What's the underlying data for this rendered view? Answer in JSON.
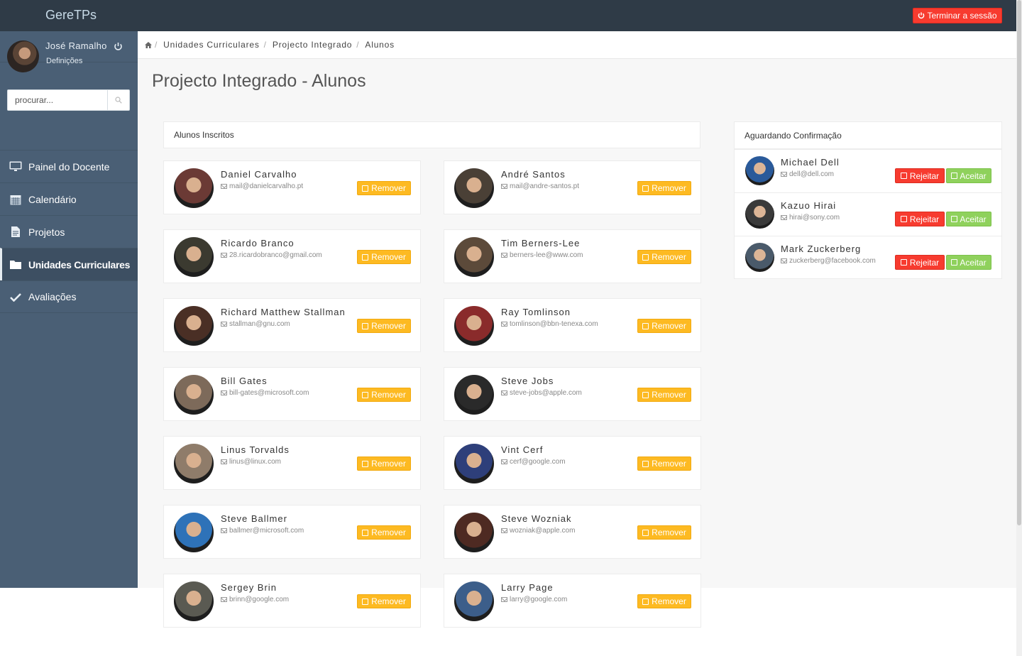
{
  "app": {
    "brand": "GereTPs",
    "logout_label": "Terminar a sessão"
  },
  "sidebar": {
    "user_name": "José Ramalho",
    "settings_label": "Definições",
    "search_placeholder": "procurar...",
    "items": [
      {
        "label": "Painel do Docente",
        "icon": "monitor-icon"
      },
      {
        "label": "Calendário",
        "icon": "calendar-icon"
      },
      {
        "label": "Projetos",
        "icon": "document-icon"
      },
      {
        "label": "Unidades Curriculares",
        "icon": "folder-icon",
        "active": true
      },
      {
        "label": "Avaliações",
        "icon": "check-icon"
      }
    ]
  },
  "breadcrumb": [
    "Unidades Curriculares",
    "Projecto Integrado",
    "Alunos"
  ],
  "page_title": "Projecto Integrado - Alunos",
  "enrolled": {
    "title": "Alunos Inscritos",
    "remove_label": "Remover",
    "students": [
      {
        "name": "Daniel Carvalho",
        "email": "mail@danielcarvalho.pt",
        "avatar": "#6b3a35"
      },
      {
        "name": "André Santos",
        "email": "mail@andre-santos.pt",
        "avatar": "#4a4036"
      },
      {
        "name": "Ricardo Branco",
        "email": "28.ricardobranco@gmail.com",
        "avatar": "#3b3a30"
      },
      {
        "name": "Tim Berners-Lee",
        "email": "berners-lee@www.com",
        "avatar": "#5c4a3a"
      },
      {
        "name": "Richard Matthew Stallman",
        "email": "stallman@gnu.com",
        "avatar": "#4a2f25"
      },
      {
        "name": "Ray Tomlinson",
        "email": "tomlinson@bbn-tenexa.com",
        "avatar": "#8a2b2b"
      },
      {
        "name": "Bill Gates",
        "email": "bill-gates@microsoft.com",
        "avatar": "#7d6a5a"
      },
      {
        "name": "Steve Jobs",
        "email": "steve-jobs@apple.com",
        "avatar": "#2a2a2a"
      },
      {
        "name": "Linus Torvalds",
        "email": "linus@linux.com",
        "avatar": "#8f7c6a"
      },
      {
        "name": "Vint Cerf",
        "email": "cerf@google.com",
        "avatar": "#2e3f7a"
      },
      {
        "name": "Steve Ballmer",
        "email": "ballmer@microsoft.com",
        "avatar": "#2e72b8"
      },
      {
        "name": "Steve Wozniak",
        "email": "wozniak@apple.com",
        "avatar": "#4e2a22"
      },
      {
        "name": "Sergey Brin",
        "email": "brinn@google.com",
        "avatar": "#5a5a52"
      },
      {
        "name": "Larry Page",
        "email": "larry@google.com",
        "avatar": "#3c5e8a"
      }
    ]
  },
  "pending": {
    "title": "Aguardando Confirmação",
    "reject_label": "Rejeitar",
    "accept_label": "Aceitar",
    "students": [
      {
        "name": "Michael Dell",
        "email": "dell@dell.com",
        "avatar": "#2a5a9a"
      },
      {
        "name": "Kazuo Hirai",
        "email": "hirai@sony.com",
        "avatar": "#3a3a3a"
      },
      {
        "name": "Mark Zuckerberg",
        "email": "zuckerberg@facebook.com",
        "avatar": "#4a5a6a"
      }
    ]
  }
}
